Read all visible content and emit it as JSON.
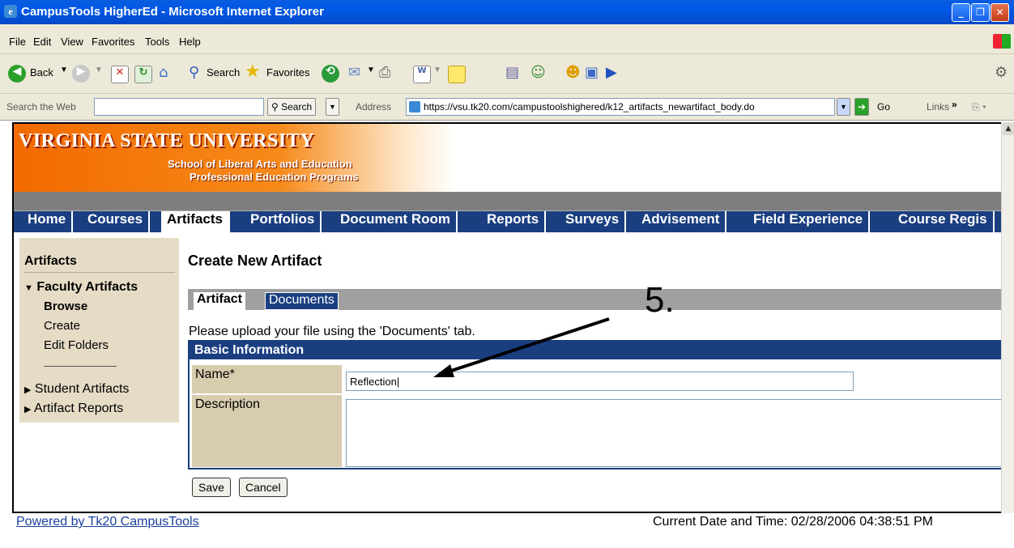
{
  "window": {
    "title": "CampusTools HigherEd - Microsoft Internet Explorer"
  },
  "menu": [
    "File",
    "Edit",
    "View",
    "Favorites",
    "Tools",
    "Help"
  ],
  "toolbar": {
    "back_label": "Back",
    "search_label": "Search",
    "favorites_label": "Favorites"
  },
  "addressbar": {
    "search_web_label": "Search the Web",
    "search_button": "Search",
    "address_label": "Address",
    "url": "https://vsu.tk20.com/campustoolshighered/k12_artifacts_newartifact_body.do",
    "go_label": "Go",
    "links_label": "Links"
  },
  "banner": {
    "university": "VIRGINIA STATE UNIVERSITY",
    "school": "School of Liberal Arts and Education",
    "program": "Professional Education Programs"
  },
  "nav": {
    "tabs": [
      "Home",
      "Courses",
      "Artifacts",
      "Portfolios",
      "Document Room",
      "Reports",
      "Surveys",
      "Advisement",
      "Field Experience",
      "Course Regis"
    ],
    "active": "Artifacts"
  },
  "sidebar": {
    "heading": "Artifacts",
    "faculty_group": "Faculty Artifacts",
    "faculty_items": [
      "Browse",
      "Create",
      "Edit Folders"
    ],
    "student_artifacts": "Student Artifacts",
    "artifact_reports": "Artifact Reports"
  },
  "main": {
    "title": "Create New Artifact",
    "tabs": [
      "Artifact",
      "Documents"
    ],
    "upload_note": "Please upload your file using the 'Documents' tab.",
    "section_title": "Basic Information",
    "name_label": "Name*",
    "name_value": "Reflection",
    "description_label": "Description",
    "save_label": "Save",
    "cancel_label": "Cancel"
  },
  "footer": {
    "powered_by": "Powered by Tk20 CampusTools",
    "datetime": "Current Date and Time: 02/28/2006 04:38:51 PM"
  },
  "annotation": {
    "step": "5."
  }
}
